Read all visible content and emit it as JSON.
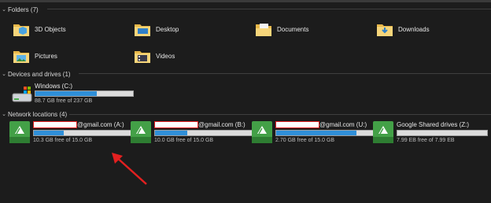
{
  "sections": {
    "folders": "Folders (7)",
    "devices": "Devices and drives (1)",
    "network": "Network locations (4)"
  },
  "folders": [
    {
      "name": "3D Objects",
      "icon": "3d-objects-folder-icon"
    },
    {
      "name": "Desktop",
      "icon": "desktop-folder-icon"
    },
    {
      "name": "Documents",
      "icon": "documents-folder-icon"
    },
    {
      "name": "Downloads",
      "icon": "downloads-folder-icon"
    },
    {
      "name": "Pictures",
      "icon": "pictures-folder-icon"
    },
    {
      "name": "Videos",
      "icon": "videos-folder-icon"
    }
  ],
  "devices": [
    {
      "name": "Windows (C:)",
      "free": "88.7 GB free of 237 GB",
      "used_fraction": 0.63,
      "icon": "windows-drive-icon"
    }
  ],
  "network": [
    {
      "suffix": "@gmail.com (A:)",
      "free": "10.3 GB free of 15.0 GB",
      "used_fraction": 0.31,
      "icon": "google-drive-icon"
    },
    {
      "suffix": "@gmail.com (B:)",
      "free": "10.0 GB free of 15.0 GB",
      "used_fraction": 0.33,
      "icon": "google-drive-icon"
    },
    {
      "suffix": "@gmail.com (U:)",
      "free": "2.70 GB free of 15.0 GB",
      "used_fraction": 0.82,
      "icon": "google-drive-icon"
    },
    {
      "label": "Google Shared drives (Z:)",
      "free": "7.99 EB free of 7.99 EB",
      "used_fraction": 0.0,
      "icon": "google-drive-icon"
    }
  ],
  "colors": {
    "bar_fill": "#2f8fd8",
    "background": "#1c1c1c",
    "annotation": "#e32020"
  }
}
